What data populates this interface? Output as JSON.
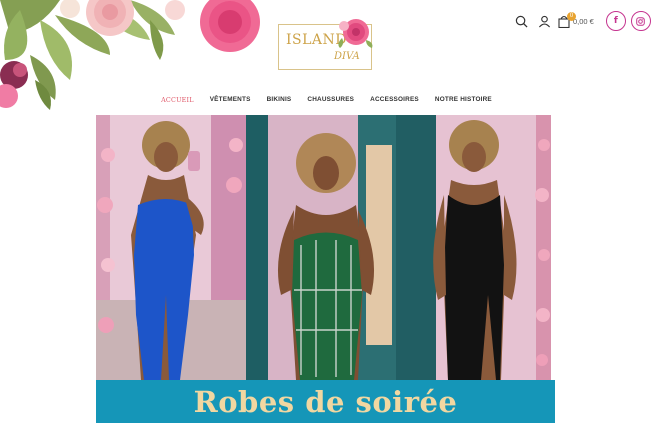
{
  "brand": {
    "line1": "ISLAND",
    "line2": "DIVA",
    "gold_color": "#cda349"
  },
  "header": {
    "search_icon": "search-icon",
    "account_icon": "user-icon",
    "cart_icon": "shopping-bag-icon",
    "cart_count": "0",
    "cart_total": "0,00 €",
    "social": [
      {
        "name": "facebook",
        "icon": "facebook-icon",
        "glyph": "f"
      },
      {
        "name": "instagram",
        "icon": "instagram-icon"
      }
    ],
    "social_color": "#c5348f"
  },
  "nav": {
    "items": [
      {
        "label": "ACCUEIL",
        "active": true
      },
      {
        "label": "VÊTEMENTS",
        "active": false
      },
      {
        "label": "BIKINIS",
        "active": false
      },
      {
        "label": "CHAUSSURES",
        "active": false
      },
      {
        "label": "ACCESSOIRES",
        "active": false
      },
      {
        "label": "NOTRE HISTOIRE",
        "active": false
      }
    ],
    "active_color": "#e05a6a"
  },
  "hero": {
    "caption": "Robes de soirée",
    "bar_color": "#1596b8",
    "caption_color": "#f1d7a1",
    "dresses": [
      {
        "color": "#1d55c9",
        "name": "blue-satin-dress"
      },
      {
        "color": "#1f6a3e",
        "name": "green-embellished-dress"
      },
      {
        "color": "#121212",
        "name": "black-slit-dress"
      }
    ]
  }
}
